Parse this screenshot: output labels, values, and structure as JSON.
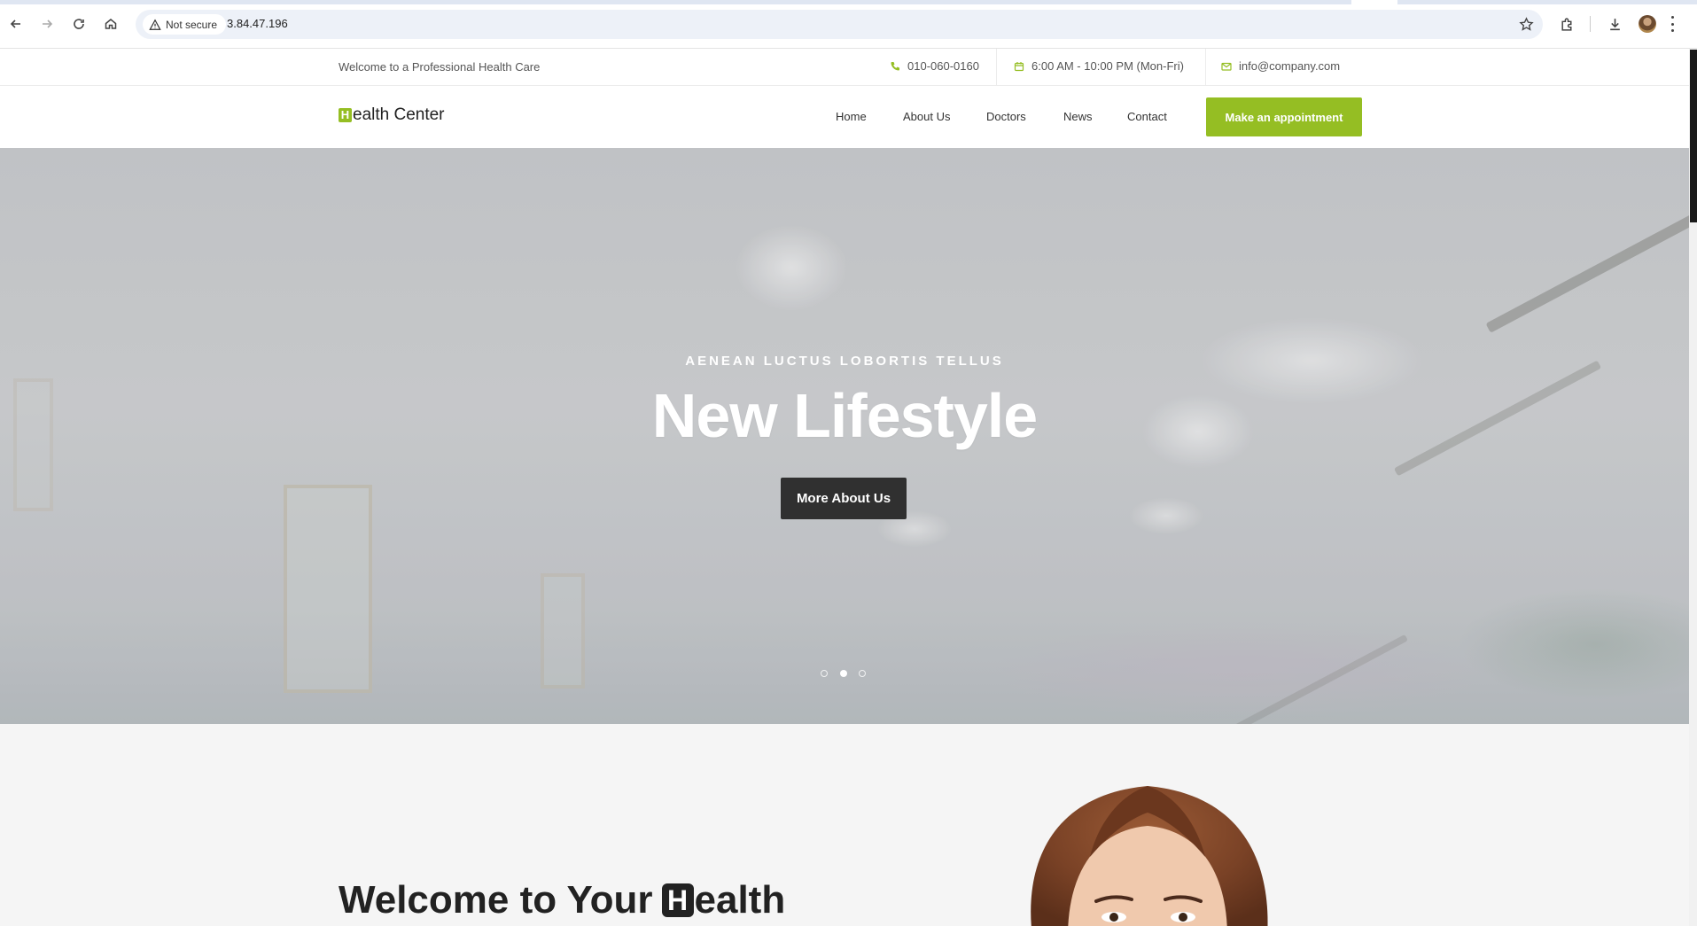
{
  "browser": {
    "security_label": "Not secure",
    "url": "3.84.47.196"
  },
  "topbar": {
    "welcome": "Welcome to a Professional Health Care",
    "phone": "010-060-0160",
    "hours": "6:00 AM - 10:00 PM (Mon-Fri)",
    "email": "info@company.com"
  },
  "header": {
    "logo_initial": "H",
    "logo_rest": "ealth Center",
    "nav": [
      "Home",
      "About Us",
      "Doctors",
      "News",
      "Contact"
    ],
    "cta": "Make an appointment"
  },
  "hero": {
    "kicker": "AENEAN LUCTUS LOBORTIS TELLUS",
    "title": "New Lifestyle",
    "button": "More About Us",
    "slides_total": 3,
    "active_slide": 2
  },
  "welcome": {
    "title_start": "Welcome to Your ",
    "title_initial": "H",
    "title_rest": "ealth"
  },
  "colors": {
    "accent": "#95be23",
    "dark_button": "#303030"
  }
}
